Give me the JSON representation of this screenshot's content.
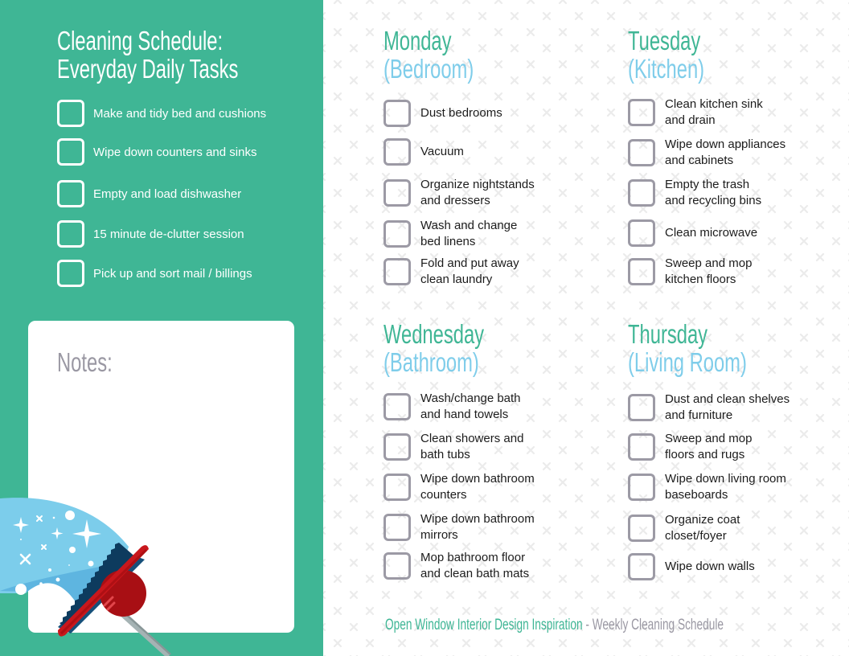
{
  "colors": {
    "panel_green": "#3fb695",
    "accent_blue": "#7fcdea",
    "checkbox_gray": "#9c9aa5",
    "muted_text": "#9a98a3",
    "body_text": "#1c1c1c",
    "squeegee_red": "#c8171c",
    "squeegee_blade": "#16507a"
  },
  "left_panel": {
    "title_line1": "Cleaning Schedule:",
    "title_line2": "Everyday Daily Tasks",
    "daily_tasks": [
      {
        "label": "Make and tidy bed and cushions",
        "checked": false
      },
      {
        "label": "Wipe down counters and sinks",
        "checked": false
      },
      {
        "label": "Empty and load dishwasher",
        "checked": false
      },
      {
        "label": "15 minute de-clutter session",
        "checked": false
      },
      {
        "label": "Pick up and sort mail / billings",
        "checked": false
      }
    ],
    "notes_label": "Notes:",
    "illustration_icon": "squeegee-icon"
  },
  "days": [
    {
      "day": "Monday",
      "room": "(Bedroom)",
      "tasks": [
        {
          "label": "Dust bedrooms",
          "checked": false
        },
        {
          "label": "Vacuum",
          "checked": false
        },
        {
          "label": "Organize nightstands\nand dressers",
          "checked": false
        },
        {
          "label": "Wash and change\nbed linens",
          "checked": false
        },
        {
          "label": "Fold and put away\nclean laundry",
          "checked": false
        }
      ]
    },
    {
      "day": "Tuesday",
      "room": "(Kitchen)",
      "tasks": [
        {
          "label": "Clean kitchen sink\nand drain",
          "checked": false
        },
        {
          "label": "Wipe down appliances\nand cabinets",
          "checked": false
        },
        {
          "label": "Empty the trash\nand recycling bins",
          "checked": false
        },
        {
          "label": "Clean microwave",
          "checked": false
        },
        {
          "label": "Sweep and mop\nkitchen floors",
          "checked": false
        }
      ]
    },
    {
      "day": "Wednesday",
      "room": "(Bathroom)",
      "tasks": [
        {
          "label": "Wash/change bath\nand hand towels",
          "checked": false
        },
        {
          "label": "Clean showers and\nbath tubs",
          "checked": false
        },
        {
          "label": "Wipe down bathroom\ncounters",
          "checked": false
        },
        {
          "label": "Wipe down bathroom\nmirrors",
          "checked": false
        },
        {
          "label": "Mop bathroom floor\nand clean bath mats",
          "checked": false
        }
      ]
    },
    {
      "day": "Thursday",
      "room": "(Living Room)",
      "tasks": [
        {
          "label": "Dust and clean shelves\nand furniture",
          "checked": false
        },
        {
          "label": "Sweep and mop\nfloors and rugs",
          "checked": false
        },
        {
          "label": "Wipe down living room\nbaseboards",
          "checked": false
        },
        {
          "label": "Organize coat\ncloset/foyer",
          "checked": false
        },
        {
          "label": "Wipe down walls",
          "checked": false
        }
      ]
    }
  ],
  "footer": {
    "brand": "Open Window Interior Design Inspiration",
    "separator_and_title": " - Weekly Cleaning Schedule"
  }
}
